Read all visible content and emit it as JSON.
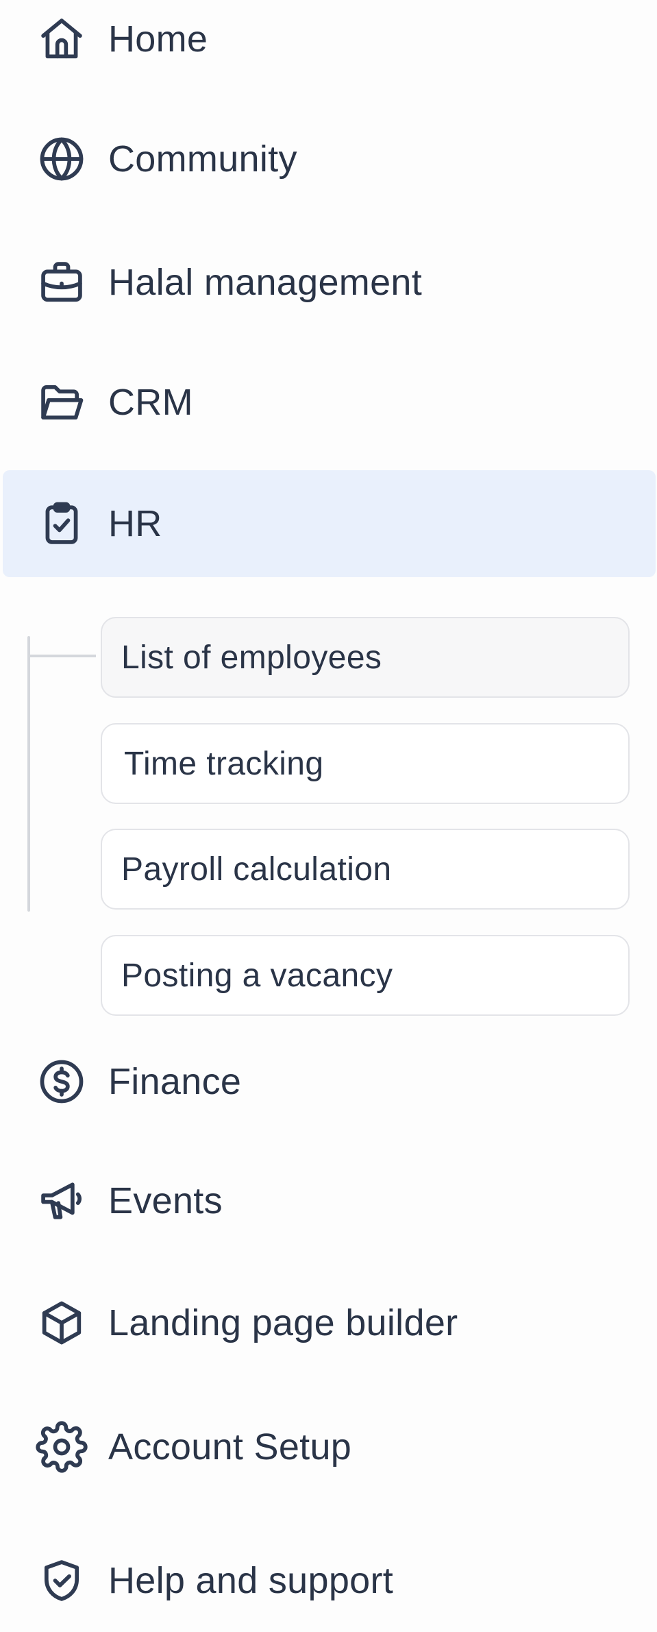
{
  "nav": {
    "home": {
      "label": "Home",
      "icon": "home-icon"
    },
    "community": {
      "label": "Community",
      "icon": "globe-icon"
    },
    "halal": {
      "label": "Halal management",
      "icon": "briefcase-icon"
    },
    "crm": {
      "label": "CRM",
      "icon": "folder-icon"
    },
    "hr": {
      "label": "HR",
      "icon": "clipboard-check-icon",
      "active": true
    },
    "finance": {
      "label": "Finance",
      "icon": "dollar-circle-icon"
    },
    "events": {
      "label": "Events",
      "icon": "megaphone-icon"
    },
    "landing": {
      "label": "Landing page builder",
      "icon": "cube-icon"
    },
    "account": {
      "label": "Account Setup",
      "icon": "gear-icon"
    },
    "help": {
      "label": "Help and support",
      "icon": "shield-check-icon"
    }
  },
  "hr_submenu": [
    {
      "label": "List of employees"
    },
    {
      "label": "Time tracking"
    },
    {
      "label": "Payroll calculation"
    },
    {
      "label": "Posting a vacancy"
    }
  ],
  "colors": {
    "active_bg": "#e9f0fc",
    "text": "#2a3447",
    "icon": "#2f3b52",
    "sub_border": "#e3e4e8",
    "rail": "#d4d7dc"
  }
}
